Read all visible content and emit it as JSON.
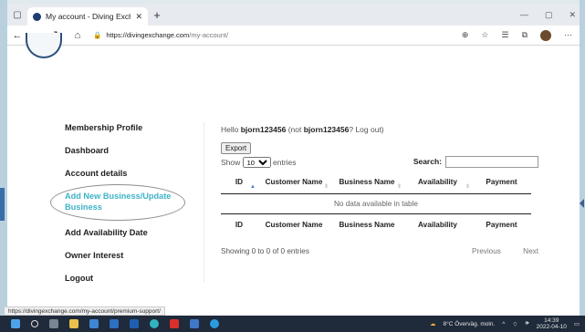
{
  "browser": {
    "tab_title": "My account - Diving Exchange",
    "url_host": "https://divingexchange.com",
    "url_path": "/my-account/",
    "status_url": "https://divingexchange.com/my-account/premium-support/"
  },
  "menu": {
    "items": [
      "Membership Profile",
      "Dashboard",
      "Account details",
      "Add New Business/Update Business",
      "Add Availability Date",
      "Owner Interest",
      "Logout"
    ]
  },
  "account": {
    "hello_prefix": "Hello ",
    "username": "bjorn123456",
    "not_prefix": " (not ",
    "username2": "bjorn123456",
    "logout_text": "? Log out)"
  },
  "table": {
    "export_label": "Export",
    "show_label": "Show",
    "entries_value": "10",
    "entries_label": "entries",
    "search_label": "Search:",
    "columns": [
      "ID",
      "Customer Name",
      "Business Name",
      "Availability",
      "Payment"
    ],
    "empty_text": "No data available in table",
    "info_text": "Showing 0 to 0 of 0 entries",
    "previous_label": "Previous",
    "next_label": "Next"
  },
  "taskbar": {
    "weather": "8°C  Överväg. moln.",
    "time": "14:39",
    "date": "2022-04-10"
  },
  "colors": {
    "accent_link": "#3fb3c9",
    "taskbar": "#1f2a3a"
  }
}
